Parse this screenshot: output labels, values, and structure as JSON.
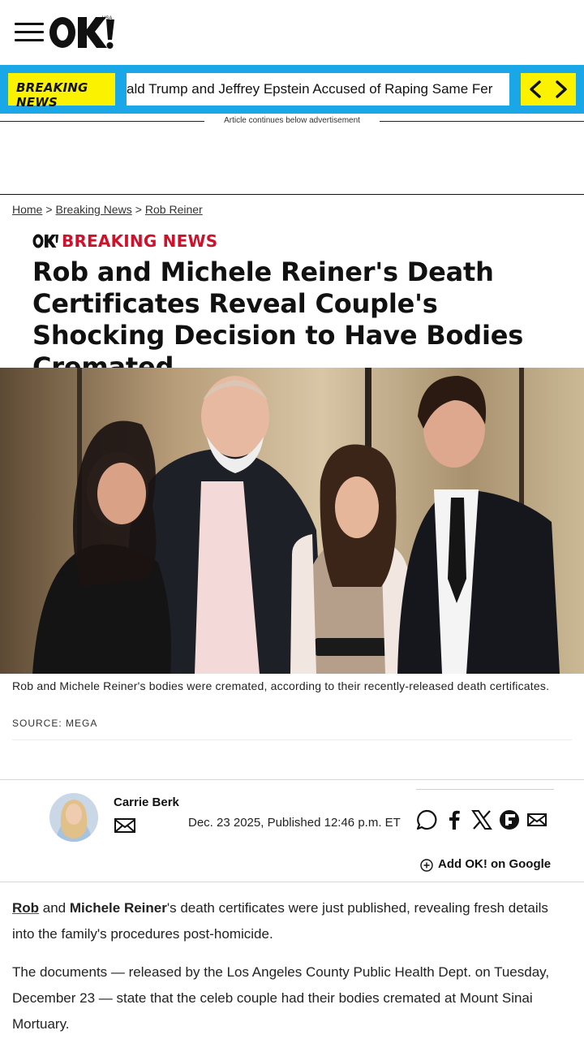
{
  "header": {
    "menu_icon": "hamburger-menu-icon",
    "logo_text": "OK!",
    "logo_sub": "USA"
  },
  "ticker": {
    "label_line1": "BREAKING",
    "label_line2": "NEWS",
    "text": "ald Trump and Jeffrey Epstein Accused of Raping Same Fer",
    "prev_icon": "chevron-left-icon",
    "next_icon": "chevron-right-icon",
    "colors": {
      "bar": "#1aa7e8",
      "label": "#fbf200"
    }
  },
  "ad": {
    "label": "Article continues below advertisement"
  },
  "breadcrumb": {
    "items": [
      "Home",
      "Breaking News",
      "Rob Reiner"
    ],
    "separator": ">"
  },
  "article": {
    "tag": "BREAKING NEWS",
    "tag_color": "#d0112b",
    "headline": "Rob and Michele Reiner's Death Certificates Reveal Couple's Shocking Decision to Have Bodies Cremated",
    "caption": "Rob and Michele Reiner's bodies were cremated, according to their recently-released death certificates.",
    "source": "SOURCE: MEGA"
  },
  "author": {
    "name": "Carrie Berk",
    "date": "Dec. 23 2025, Published 12:46 p.m. ET",
    "share_icons": [
      "comment-icon",
      "facebook-icon",
      "x-icon",
      "flipboard-icon",
      "email-icon"
    ]
  },
  "google": {
    "label": "Add OK! on Google"
  },
  "body": {
    "p1_link": "Rob",
    "p1_and": " and ",
    "p1_name": "Michele Reiner",
    "p1_rest": "'s death certificates were just published, revealing fresh details into the family's procedures post-homicide.",
    "p2": "The documents — released by the Los Angeles County Public Health Dept. on Tuesday, December 23 — state that the celeb couple had their bodies cremated at Mount Sinai Mortuary."
  }
}
